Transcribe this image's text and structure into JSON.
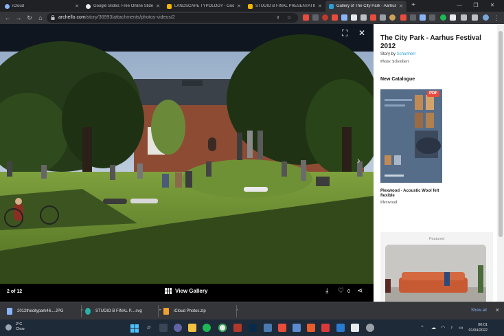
{
  "browser": {
    "tabs": [
      {
        "label": "iCloud",
        "color": "#8ab4f8"
      },
      {
        "label": "Google Slides: Free Online Slidesh",
        "color": "#f4b400"
      },
      {
        "label": "LANDSCAPE TYPOLOGY - Google S",
        "color": "#f4b400"
      },
      {
        "label": "STUDIO B FINAL PRESENTATION - G",
        "color": "#f4b400"
      },
      {
        "label": "Gallery of The City Park - Aarhus",
        "color": "#2a9fd8"
      }
    ],
    "url_host": "archello.com",
    "url_path": "/story/36993/attachments/photos-videos/2"
  },
  "viewer": {
    "counter": "2 of 12",
    "gallery_label": "View Gallery",
    "like_count": "0"
  },
  "sidebar": {
    "title": "The City Park - Aarhus Festival 2012",
    "story_prefix": "Story by",
    "story_author": "Schonherr",
    "photo_credit": "Photo: Schonherr",
    "section_heading": "New Catalogue",
    "catalogue": {
      "badge": "PDF",
      "name": "Plexwood - Acoustic Wool felt flexible",
      "brand": "Plexwood"
    },
    "featured_label": "Featured"
  },
  "downloads": {
    "items": [
      {
        "name": "2012thecitypark46....JPG",
        "color": "#8ab4f8"
      },
      {
        "name": "STUDIO B FINAL P....svg",
        "color": "#27b3a8"
      },
      {
        "name": "iCloud Photos.zip",
        "color": "#f0a030"
      }
    ],
    "show_all": "Show all"
  },
  "taskbar": {
    "weather_temp": "2°C",
    "weather_desc": "Clear",
    "time": "00:01",
    "date": "01/04/2022"
  }
}
